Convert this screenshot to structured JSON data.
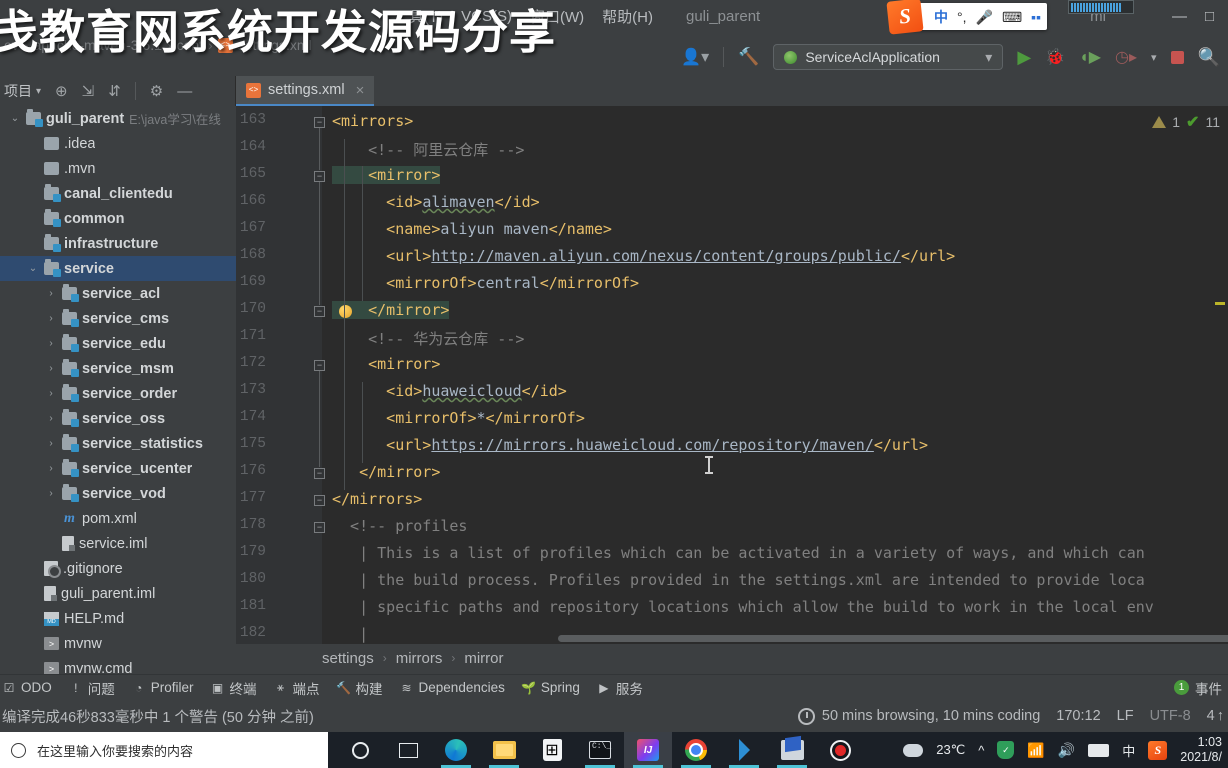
{
  "menu": {
    "items": [
      "具(T)",
      "VCS(S)",
      "窗口(W)",
      "帮助(H)"
    ],
    "project_name": "guli_parent",
    "file_suffix": "ml",
    "minimize": "—"
  },
  "ime": {
    "logo": "S",
    "mode": "中",
    "voice_dot": "°,",
    "mic": "mic-glyph",
    "keyboard": "keyboard-glyph",
    "apps": "apps-glyph"
  },
  "overlay": {
    "title": "戋教育网系统开发源码分享"
  },
  "navpath": {
    "crumbs": [
      "ev",
      "apache-maven-3.6.1",
      "conf",
      "settings.xml"
    ]
  },
  "toolbar": {
    "run_config": "ServiceAclApplication",
    "icons": [
      "user-icon",
      "build-hammer-icon",
      "run-icon",
      "debug-icon",
      "run-coverage-icon",
      "profile-icon",
      "stop-icon",
      "search-icon"
    ]
  },
  "project_pane": {
    "title": "项目",
    "tree": [
      {
        "label": "guli_parent",
        "sub": "E:\\java学习\\在线",
        "icon": "module-folder",
        "indent": 0,
        "arrow": "v",
        "bold": true
      },
      {
        "label": ".idea",
        "sub": "",
        "icon": "folder",
        "indent": 1,
        "arrow": "",
        "bold": false
      },
      {
        "label": ".mvn",
        "sub": "",
        "icon": "folder",
        "indent": 1,
        "arrow": "",
        "bold": false
      },
      {
        "label": "canal_clientedu",
        "sub": "",
        "icon": "module-folder",
        "indent": 1,
        "arrow": "",
        "bold": true
      },
      {
        "label": "common",
        "sub": "",
        "icon": "module-folder",
        "indent": 1,
        "arrow": "",
        "bold": true
      },
      {
        "label": "infrastructure",
        "sub": "",
        "icon": "module-folder",
        "indent": 1,
        "arrow": "",
        "bold": true
      },
      {
        "label": "service",
        "sub": "",
        "icon": "module-folder",
        "indent": 1,
        "arrow": "v",
        "bold": true,
        "selected": true
      },
      {
        "label": "service_acl",
        "sub": "",
        "icon": "module-folder",
        "indent": 2,
        "arrow": ">",
        "bold": true
      },
      {
        "label": "service_cms",
        "sub": "",
        "icon": "module-folder",
        "indent": 2,
        "arrow": ">",
        "bold": true
      },
      {
        "label": "service_edu",
        "sub": "",
        "icon": "module-folder",
        "indent": 2,
        "arrow": ">",
        "bold": true
      },
      {
        "label": "service_msm",
        "sub": "",
        "icon": "module-folder",
        "indent": 2,
        "arrow": ">",
        "bold": true
      },
      {
        "label": "service_order",
        "sub": "",
        "icon": "module-folder",
        "indent": 2,
        "arrow": ">",
        "bold": true
      },
      {
        "label": "service_oss",
        "sub": "",
        "icon": "module-folder",
        "indent": 2,
        "arrow": ">",
        "bold": true
      },
      {
        "label": "service_statistics",
        "sub": "",
        "icon": "module-folder",
        "indent": 2,
        "arrow": ">",
        "bold": true
      },
      {
        "label": "service_ucenter",
        "sub": "",
        "icon": "module-folder",
        "indent": 2,
        "arrow": ">",
        "bold": true
      },
      {
        "label": "service_vod",
        "sub": "",
        "icon": "module-folder",
        "indent": 2,
        "arrow": ">",
        "bold": true
      },
      {
        "label": "pom.xml",
        "sub": "",
        "icon": "maven",
        "indent": 2,
        "arrow": "",
        "bold": false
      },
      {
        "label": "service.iml",
        "sub": "",
        "icon": "iml",
        "indent": 2,
        "arrow": "",
        "bold": false
      },
      {
        "label": ".gitignore",
        "sub": "",
        "icon": "gitignore",
        "indent": 1,
        "arrow": "",
        "bold": false
      },
      {
        "label": "guli_parent.iml",
        "sub": "",
        "icon": "iml",
        "indent": 1,
        "arrow": "",
        "bold": false
      },
      {
        "label": "HELP.md",
        "sub": "",
        "icon": "markdown",
        "indent": 1,
        "arrow": "",
        "bold": false
      },
      {
        "label": "mvnw",
        "sub": "",
        "icon": "shell",
        "indent": 1,
        "arrow": "",
        "bold": false
      },
      {
        "label": "mvnw.cmd",
        "sub": "",
        "icon": "shell",
        "indent": 1,
        "arrow": "",
        "bold": false
      }
    ]
  },
  "editor": {
    "tab_label": "settings.xml",
    "tab_close": "×",
    "inspection": {
      "warning_count": "1",
      "check_count": "11"
    },
    "first_line_number": 163,
    "lines": [
      {
        "n": 163,
        "segs": [
          {
            "t": "<mirrors>",
            "c": "tagc"
          }
        ],
        "indent": 0
      },
      {
        "n": 164,
        "segs": [
          {
            "t": "    <!-- 阿里云仓库 -->",
            "c": "cmt"
          }
        ],
        "indent": 1
      },
      {
        "n": 165,
        "segs": [
          {
            "t": "    <mirror>",
            "c": "tagc hl"
          }
        ],
        "indent": 1
      },
      {
        "n": 166,
        "segs": [
          {
            "t": "      <id>",
            "c": "tagc"
          },
          {
            "t": "alimaven",
            "c": "typo"
          },
          {
            "t": "</id>",
            "c": "tagc"
          }
        ],
        "indent": 2
      },
      {
        "n": 167,
        "segs": [
          {
            "t": "      <name>",
            "c": "tagc"
          },
          {
            "t": "aliyun maven",
            "c": "txtc"
          },
          {
            "t": "</name>",
            "c": "tagc"
          }
        ],
        "indent": 2
      },
      {
        "n": 168,
        "segs": [
          {
            "t": "      <url>",
            "c": "tagc"
          },
          {
            "t": "http://maven.aliyun.com/nexus/content/groups/public/",
            "c": "urlv"
          },
          {
            "t": "</url>",
            "c": "tagc"
          }
        ],
        "indent": 2
      },
      {
        "n": 169,
        "segs": [
          {
            "t": "      <mirrorOf>",
            "c": "tagc"
          },
          {
            "t": "central",
            "c": "txtc"
          },
          {
            "t": "</mirrorOf>",
            "c": "tagc"
          }
        ],
        "indent": 2
      },
      {
        "n": 170,
        "segs": [
          {
            "t": "    </mirror>",
            "c": "tagc hl"
          }
        ],
        "indent": 1
      },
      {
        "n": 171,
        "segs": [
          {
            "t": "    <!-- 华为云仓库 -->",
            "c": "cmt"
          }
        ],
        "indent": 1
      },
      {
        "n": 172,
        "segs": [
          {
            "t": "    <mirror>",
            "c": "tagc"
          }
        ],
        "indent": 1
      },
      {
        "n": 173,
        "segs": [
          {
            "t": "      <id>",
            "c": "tagc"
          },
          {
            "t": "huaweicloud",
            "c": "typo"
          },
          {
            "t": "</id>",
            "c": "tagc"
          }
        ],
        "indent": 2
      },
      {
        "n": 174,
        "segs": [
          {
            "t": "      <mirrorOf>",
            "c": "tagc"
          },
          {
            "t": "*",
            "c": "txtc"
          },
          {
            "t": "</mirrorOf>",
            "c": "tagc"
          }
        ],
        "indent": 2
      },
      {
        "n": 175,
        "segs": [
          {
            "t": "      <url>",
            "c": "tagc"
          },
          {
            "t": "https://mirrors.huaweicloud.com/repository/maven/",
            "c": "urlv"
          },
          {
            "t": "</url>",
            "c": "tagc"
          }
        ],
        "indent": 2
      },
      {
        "n": 176,
        "segs": [
          {
            "t": "   </mirror>",
            "c": "tagc"
          }
        ],
        "indent": 1
      },
      {
        "n": 177,
        "segs": [
          {
            "t": "</mirrors>",
            "c": "tagc"
          }
        ],
        "indent": 0
      },
      {
        "n": 178,
        "segs": [
          {
            "t": "  <!-- profiles",
            "c": "cmt"
          }
        ],
        "indent": 0
      },
      {
        "n": 179,
        "segs": [
          {
            "t": "   | This is a list of profiles which can be activated in a variety of ways, and which can",
            "c": "cmt"
          }
        ],
        "indent": 0
      },
      {
        "n": 180,
        "segs": [
          {
            "t": "   | the build process. Profiles provided in the settings.xml are intended to provide loca",
            "c": "cmt"
          }
        ],
        "indent": 0
      },
      {
        "n": 181,
        "segs": [
          {
            "t": "   | specific paths and repository locations which allow the build to work in the local env",
            "c": "cmt"
          }
        ],
        "indent": 0
      },
      {
        "n": 182,
        "segs": [
          {
            "t": "   |",
            "c": "cmt"
          }
        ],
        "indent": 0
      }
    ]
  },
  "crumbbar": {
    "items": [
      "settings",
      "mirrors",
      "mirror"
    ],
    "sep": "›"
  },
  "toolwindows": {
    "items": [
      {
        "label": "ODO",
        "icon": "todo-icon"
      },
      {
        "label": "问题",
        "icon": "problems-icon"
      },
      {
        "label": "Profiler",
        "icon": "profiler-icon"
      },
      {
        "label": "终端",
        "icon": "terminal-icon"
      },
      {
        "label": "端点",
        "icon": "endpoints-icon"
      },
      {
        "label": "构建",
        "icon": "build-icon"
      },
      {
        "label": "Dependencies",
        "icon": "dependencies-icon"
      },
      {
        "label": "Spring",
        "icon": "spring-icon"
      },
      {
        "label": "服务",
        "icon": "services-icon"
      }
    ],
    "right_badge": "1",
    "right_label": "事件"
  },
  "statusbar": {
    "message": "编译完成46秒833毫秒中 1 个警告 (50 分钟 之前)",
    "activity": "50 mins browsing, 10 mins coding",
    "position": "170:12",
    "line_sep": "LF",
    "encoding": "UTF-8",
    "indent": "4",
    "indent_arrow": "↑",
    "trailing": "4"
  },
  "taskbar": {
    "search_placeholder": "在这里输入你要搜索的内容",
    "icons": [
      {
        "name": "cortana-icon"
      },
      {
        "name": "task-view-icon"
      },
      {
        "name": "edge-icon"
      },
      {
        "name": "file-explorer-icon"
      },
      {
        "name": "microsoft-store-icon"
      },
      {
        "name": "terminal-icon"
      },
      {
        "name": "intellij-idea-icon"
      },
      {
        "name": "chrome-icon"
      },
      {
        "name": "vscode-icon"
      },
      {
        "name": "navicat-icon"
      },
      {
        "name": "screen-recorder-icon"
      }
    ],
    "weather": "23℃",
    "chevron": "^",
    "ime_lang": "中",
    "time": "1:03",
    "date": "2021/8/"
  }
}
